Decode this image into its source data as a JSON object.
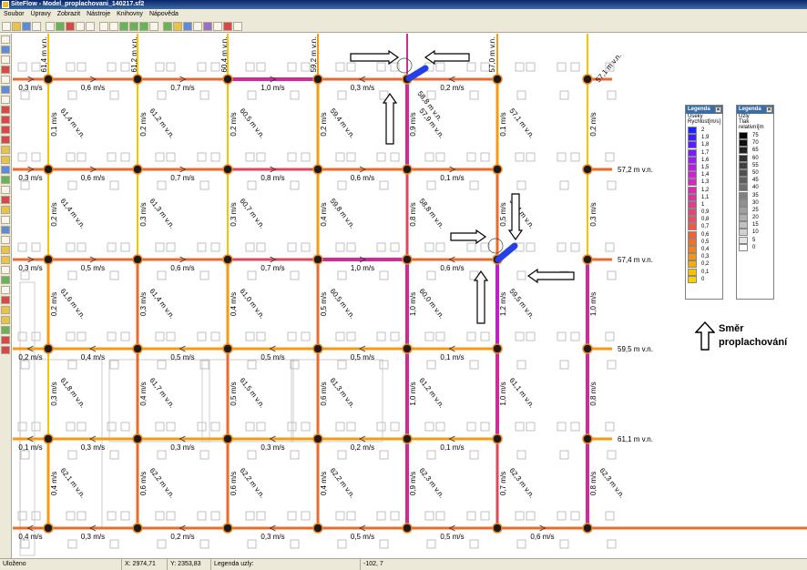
{
  "window": {
    "title": "SiteFlow - Model_proplachovani_140217.sf2"
  },
  "menu": {
    "items": [
      "Soubor",
      "Úpravy",
      "Zobrazit",
      "Nástroje",
      "Knihovny",
      "Nápověda"
    ]
  },
  "toolbar": {
    "icons": [
      "new-icon",
      "open-icon",
      "save-icon",
      "print-icon",
      "zoom-icon",
      "zoom-in-icon",
      "zoom-out-icon",
      "zoom-fit-icon",
      "select-icon",
      "move-icon",
      "pipe-icon",
      "node-icon",
      "valve-icon",
      "hydrant-icon",
      "pump-icon",
      "tank-icon",
      "calculate-icon"
    ]
  },
  "grid": {
    "colors": {
      "c0": "#f5c400",
      "c1": "#f59a12",
      "c2": "#ee6a2a",
      "c3": "#e0475a",
      "c4": "#d02a9a",
      "c5": "#c020c8",
      "c6": "#2540e8"
    },
    "horizontal_pipes": [
      {
        "segments": [
          {
            "label": "0,3 m/s",
            "dir": "right",
            "color": "c2"
          },
          {
            "label": "0,6 m/s",
            "dir": "right",
            "color": "c2"
          },
          {
            "label": "0,7 m/s",
            "dir": "right",
            "color": "c2"
          },
          {
            "label": "1,0 m/s",
            "dir": "right",
            "color": "c4"
          },
          {
            "label": "0,3 m/s",
            "dir": "left",
            "color": "c2"
          },
          {
            "label": "0,2 m/s",
            "dir": "left",
            "color": "c2"
          }
        ]
      },
      {
        "segments": [
          {
            "label": "0,3 m/s",
            "dir": "right",
            "color": "c2"
          },
          {
            "label": "0,6 m/s",
            "dir": "right",
            "color": "c2"
          },
          {
            "label": "0,7 m/s",
            "dir": "right",
            "color": "c2"
          },
          {
            "label": "0,8 m/s",
            "dir": "right",
            "color": "c3"
          },
          {
            "label": "0,6 m/s",
            "dir": "right",
            "color": "c2"
          },
          {
            "label": "0,1 m/s",
            "dir": "right",
            "color": "c2"
          }
        ]
      },
      {
        "segments": [
          {
            "label": "0,3 m/s",
            "dir": "right",
            "color": "c2"
          },
          {
            "label": "0,5 m/s",
            "dir": "right",
            "color": "c2"
          },
          {
            "label": "0,6 m/s",
            "dir": "right",
            "color": "c2"
          },
          {
            "label": "0,7 m/s",
            "dir": "right",
            "color": "c3"
          },
          {
            "label": "1,0 m/s",
            "dir": "right",
            "color": "c4"
          },
          {
            "label": "0,6 m/s",
            "dir": "left",
            "color": "c2"
          }
        ]
      },
      {
        "segments": [
          {
            "label": "0,2 m/s",
            "dir": "left",
            "color": "c1"
          },
          {
            "label": "0,4 m/s",
            "dir": "left",
            "color": "c1"
          },
          {
            "label": "0,5 m/s",
            "dir": "left",
            "color": "c1"
          },
          {
            "label": "0,5 m/s",
            "dir": "left",
            "color": "c1"
          },
          {
            "label": "0,5 m/s",
            "dir": "left",
            "color": "c1"
          },
          {
            "label": "0,1 m/s",
            "dir": "left",
            "color": "c1"
          }
        ]
      },
      {
        "segments": [
          {
            "label": "0,1 m/s",
            "dir": "left",
            "color": "c1"
          },
          {
            "label": "0,3 m/s",
            "dir": "left",
            "color": "c1"
          },
          {
            "label": "0,3 m/s",
            "dir": "left",
            "color": "c1"
          },
          {
            "label": "0,3 m/s",
            "dir": "left",
            "color": "c1"
          },
          {
            "label": "0,2 m/s",
            "dir": "left",
            "color": "c1"
          },
          {
            "label": "0,1 m/s",
            "dir": "left",
            "color": "c1"
          }
        ]
      },
      {
        "segments": [
          {
            "label": "0,4 m/s",
            "dir": "left",
            "color": "c2"
          },
          {
            "label": "0,3 m/s",
            "dir": "left",
            "color": "c2"
          },
          {
            "label": "0,2 m/s",
            "dir": "left",
            "color": "c2"
          },
          {
            "label": "0,3 m/s",
            "dir": "left",
            "color": "c2"
          },
          {
            "label": "0,5 m/s",
            "dir": "left",
            "color": "c2"
          },
          {
            "label": "0,5 m/s",
            "dir": "left",
            "color": "c2"
          },
          {
            "label": "0,6 m/s",
            "dir": "right",
            "color": "c2"
          }
        ]
      }
    ],
    "vertical_pipes": [
      {
        "segments": [
          {
            "label": "0,1 m/s",
            "color": "c0"
          },
          {
            "label": "0,2 m/s",
            "color": "c0"
          },
          {
            "label": "0,2 m/s",
            "color": "c1"
          },
          {
            "label": "0,3 m/s",
            "color": "c0"
          },
          {
            "label": "0,4 m/s",
            "color": "c1"
          }
        ]
      },
      {
        "segments": [
          {
            "label": "0,2 m/s",
            "color": "c0"
          },
          {
            "label": "0,3 m/s",
            "color": "c0"
          },
          {
            "label": "0,3 m/s",
            "color": "c2"
          },
          {
            "label": "0,4 m/s",
            "color": "c2"
          },
          {
            "label": "0,6 m/s",
            "color": "c2"
          }
        ]
      },
      {
        "segments": [
          {
            "label": "0,2 m/s",
            "color": "c0"
          },
          {
            "label": "0,3 m/s",
            "color": "c0"
          },
          {
            "label": "0,4 m/s",
            "color": "c1"
          },
          {
            "label": "0,5 m/s",
            "color": "c2"
          },
          {
            "label": "0,6 m/s",
            "color": "c2"
          }
        ]
      },
      {
        "segments": [
          {
            "label": "0,2 m/s",
            "color": "c1"
          },
          {
            "label": "0,4 m/s",
            "color": "c1"
          },
          {
            "label": "0,5 m/s",
            "color": "c2"
          },
          {
            "label": "0,6 m/s",
            "color": "c2"
          },
          {
            "label": "0,4 m/s",
            "color": "c2"
          }
        ]
      },
      {
        "segments": [
          {
            "label": "0,9 m/s",
            "color": "c4"
          },
          {
            "label": "0,8 m/s",
            "color": "c3"
          },
          {
            "label": "1,0 m/s",
            "color": "c4"
          },
          {
            "label": "1,0 m/s",
            "color": "c4"
          },
          {
            "label": "0,9 m/s",
            "color": "c4"
          }
        ]
      },
      {
        "segments": [
          {
            "label": "0,1 m/s",
            "color": "c1"
          },
          {
            "label": "0,5 m/s",
            "color": "c2"
          },
          {
            "label": "1,2 m/s",
            "color": "c5"
          },
          {
            "label": "1,0 m/s",
            "color": "c4"
          },
          {
            "label": "0,7 m/s",
            "color": "c3"
          }
        ]
      },
      {
        "segments": [
          {
            "label": "0,2 m/s",
            "color": "c0"
          },
          {
            "label": "0,3 m/s",
            "color": "c0"
          },
          {
            "label": "1,0 m/s",
            "color": "c4"
          },
          {
            "label": "0,8 m/s",
            "color": "c4"
          },
          {
            "label": "0,8 m/s",
            "color": "c4"
          }
        ]
      }
    ],
    "top_labels": [
      "61,4 m v.n.",
      "61,2 m v.n.",
      "60,4 m v.n.",
      "59,2 m v.n.",
      "57,0 m v.n."
    ],
    "right_labels": [
      "57,1 m v.n.",
      "57,2 m v.n.",
      "57,4 m v.n.",
      "59,5 m v.n.",
      "61,1 m v.n."
    ],
    "diagonal_labels": [
      [
        "58,8 m v.n."
      ],
      [
        "61,4 m v.n.",
        "61,2 m v.n.",
        "60,5 m v.n.",
        "59,4 m v.n.",
        "57,9 m v.n.",
        "57,1 m v.n."
      ],
      [
        "61,4 m v.n.",
        "61,3 m v.n.",
        "60,7 m v.n.",
        "59,8 m v.n.",
        "58,8 m v.n.",
        "58,4 m v.n."
      ],
      [
        "61,6 m v.n.",
        "61,4 m v.n.",
        "61,0 m v.n.",
        "60,5 m v.n.",
        "60,0 m v.n.",
        "59,5 m v.n."
      ],
      [
        "61,8 m v.n.",
        "61,7 m v.n.",
        "61,5 m v.n.",
        "61,3 m v.n.",
        "61,2 m v.n.",
        "61,1 m v.n."
      ],
      [
        "62,1 m v.n.",
        "62,2 m v.n.",
        "62,2 m v.n.",
        "62,2 m v.n.",
        "62,3 m v.n.",
        "62,3 m v.n.",
        "62,3 m v.n."
      ]
    ]
  },
  "legend_velocity": {
    "title": "Legenda",
    "subtitle_1": "Úseky",
    "subtitle_2": "Rychlost[m/s]",
    "values": [
      "2",
      "1,9",
      "1,8",
      "1,7",
      "1,6",
      "1,5",
      "1,4",
      "1,3",
      "1,2",
      "1,1",
      "1",
      "0,9",
      "0,8",
      "0,7",
      "0,6",
      "0,5",
      "0,4",
      "0,3",
      "0,2",
      "0,1",
      "0"
    ],
    "colors": [
      "#1d22ff",
      "#3a1fff",
      "#5a1dff",
      "#7a1cff",
      "#9c1cf5",
      "#bd1ce6",
      "#d11fd6",
      "#d626c4",
      "#d92eb2",
      "#dd35a0",
      "#e03d8d",
      "#e4467a",
      "#e84f63",
      "#ec594c",
      "#f06434",
      "#f27028",
      "#f4801f",
      "#f69416",
      "#f8ab0d",
      "#fac106",
      "#fcd000"
    ]
  },
  "legend_pressure": {
    "title": "Legenda",
    "subtitle_1": "Uzly",
    "subtitle_2": "Tlak relativní[m",
    "values": [
      "75",
      "70",
      "65",
      "60",
      "55",
      "50",
      "45",
      "40",
      "35",
      "30",
      "25",
      "20",
      "15",
      "10",
      "5",
      "0"
    ],
    "colors": [
      "#000000",
      "#101010",
      "#202020",
      "#303030",
      "#404040",
      "#505050",
      "#606060",
      "#707070",
      "#808080",
      "#909090",
      "#a0a0a0",
      "#b0b0b0",
      "#c0c0c0",
      "#d0d0d0",
      "#e4e4e4",
      "#ffffff"
    ]
  },
  "direction_note": {
    "line1": "Směr",
    "line2": "proplachování"
  },
  "statusbar": {
    "state": "Uloženo",
    "x": "X: 2974,71",
    "y": "Y: 2353,83",
    "legend": "Legenda uzly:",
    "value": "-102, 7"
  }
}
